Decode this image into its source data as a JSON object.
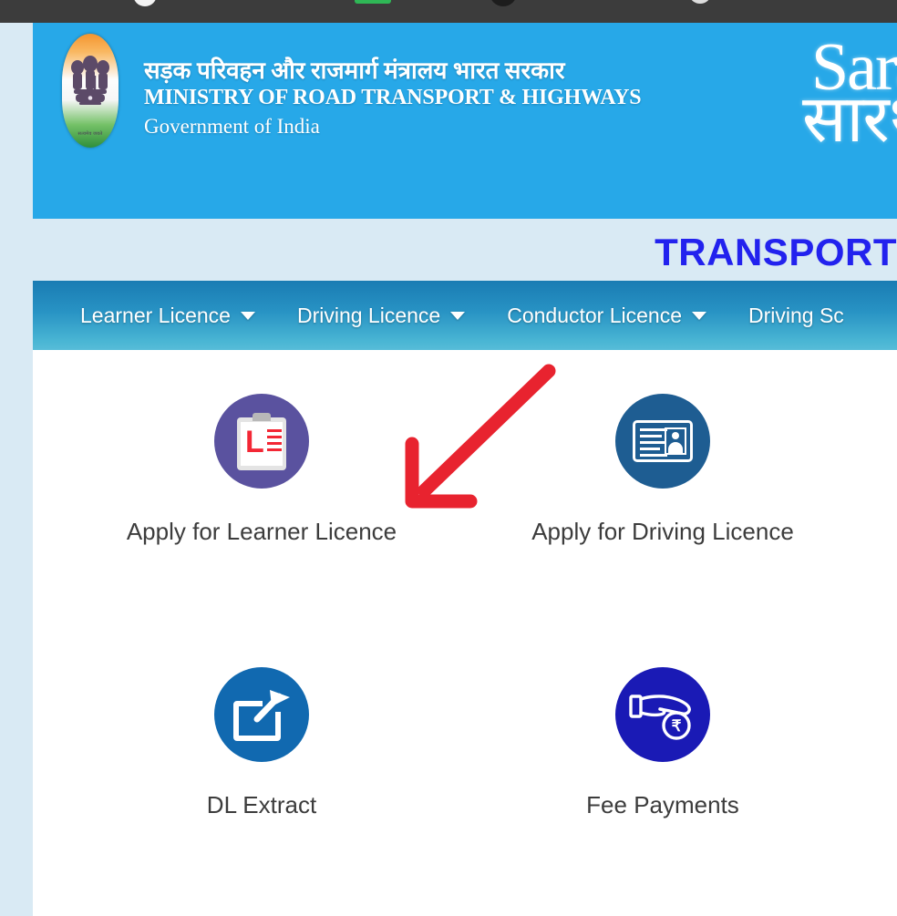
{
  "browser": {
    "strip_color": "#3c3c3c"
  },
  "header": {
    "background_color": "#27a8e8",
    "emblem_name": "india-national-emblem-icon",
    "emblem_motto": "सत्यमेव जयते",
    "title_hindi": "सड़क परिवहन और राजमार्ग मंत्रालय भारत सरकार",
    "title_english": "MINISTRY OF ROAD TRANSPORT & HIGHWAYS",
    "title_government": "Government of India",
    "logo_text_english": "Sarathi",
    "logo_text_hindi": "सारथी"
  },
  "page": {
    "background_color": "#d9eaf4",
    "title": "TRANSPORT",
    "title_color": "#2222ee"
  },
  "nav": {
    "gradient_top": "#1a7cb3",
    "gradient_bottom": "#57bcd8",
    "items": [
      {
        "label": "Learner Licence",
        "has_caret": true
      },
      {
        "label": "Driving Licence",
        "has_caret": true
      },
      {
        "label": "Conductor Licence",
        "has_caret": true
      },
      {
        "label": "Driving Sc",
        "has_caret": false
      }
    ]
  },
  "tiles": [
    {
      "label": "Apply for Learner Licence",
      "icon": "learner-licence-clipboard-icon",
      "circle_color": "#5a529f",
      "accent_color": "#f32735"
    },
    {
      "label": "Apply for Driving Licence",
      "icon": "driving-licence-id-card-icon",
      "circle_color": "#1e5d92",
      "accent_color": "#ffffff"
    },
    {
      "label": "DL Extract",
      "icon": "dl-extract-external-link-icon",
      "circle_color": "#1169b0",
      "accent_color": "#ffffff"
    },
    {
      "label": "Fee Payments",
      "icon": "fee-payments-hand-rupee-icon",
      "circle_color": "#1a1ab5",
      "accent_color": "#ffffff"
    }
  ],
  "annotation": {
    "name": "red-arrow-pointing-to-learner-licence-tile",
    "color": "#e8232f",
    "direction": "down-left"
  }
}
